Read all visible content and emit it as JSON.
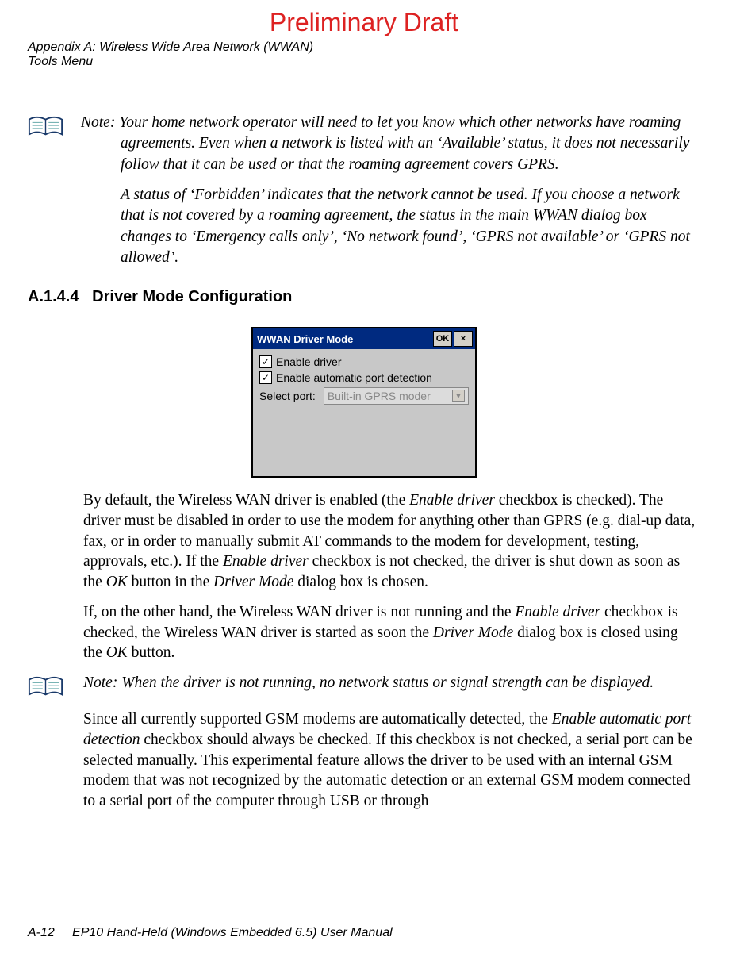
{
  "draft": "Preliminary Draft",
  "appendix_line1": "Appendix A: Wireless Wide Area Network (WWAN)",
  "appendix_line2": "Tools Menu",
  "note1": {
    "label": "Note:",
    "p1": "Your home network operator will need to let you know which other networks have roaming agreements. Even when a network is listed with an ‘Available’ status, it does not necessarily follow that it can be used or that the roaming agreement covers GPRS.",
    "p2": "A status of ‘Forbidden’ indicates that the network cannot be used. If you choose a network that is not covered by a roaming agreement, the status in the main WWAN dialog box changes to ‘Emergency calls only’, ‘No network found’, ‘GPRS not available’ or ‘GPRS not allowed’."
  },
  "section": {
    "num": "A.1.4.4",
    "title": "Driver Mode Configuration"
  },
  "dialog": {
    "title": "WWAN Driver Mode",
    "ok": "OK",
    "close": "×",
    "chk1_checked": true,
    "chk1": "Enable driver",
    "chk2_checked": true,
    "chk2": "Enable automatic port detection",
    "port_label": "Select port:",
    "port_value": "Built-in GPRS moder"
  },
  "body1": {
    "t1": "By default, the Wireless WAN driver is enabled (the ",
    "i1": "Enable driver",
    "t2": " checkbox is checked). The driver must be disabled in order to use the modem for anything other than GPRS (e.g. dial-up data, fax, or in order to manually submit AT commands to the modem for development, testing, approvals, etc.). If the ",
    "i2": "Enable driver",
    "t3": " checkbox is not checked, the driver is shut down as soon as the ",
    "i3": "OK",
    "t4": " button in the ",
    "i4": "Driver Mode",
    "t5": " dialog box is chosen."
  },
  "body2": {
    "t1": "If, on the other hand, the Wireless WAN driver is not running and the ",
    "i1": "Enable driver",
    "t2": " checkbox is checked, the Wireless WAN driver is started as soon the ",
    "i2": "Driver Mode",
    "t3": " dialog box is closed using the ",
    "i3": "OK",
    "t4": " button."
  },
  "note2": {
    "label": "Note:",
    "text": "When the driver is not running, no network status or signal strength can be displayed."
  },
  "body3": {
    "t1": "Since all currently supported GSM modems are automatically detected, the ",
    "i1": "Enable automatic port detection",
    "t2": " checkbox should always be checked. If this checkbox is not checked, a serial port can be selected manually. This experimental feature allows the driver to be used with an internal GSM modem that was not recognized by the automatic detection or an external GSM modem connected to a serial port of the computer through USB or through"
  },
  "footer": {
    "page": "A-12",
    "title": "EP10 Hand-Held (Windows Embedded 6.5) User Manual"
  }
}
